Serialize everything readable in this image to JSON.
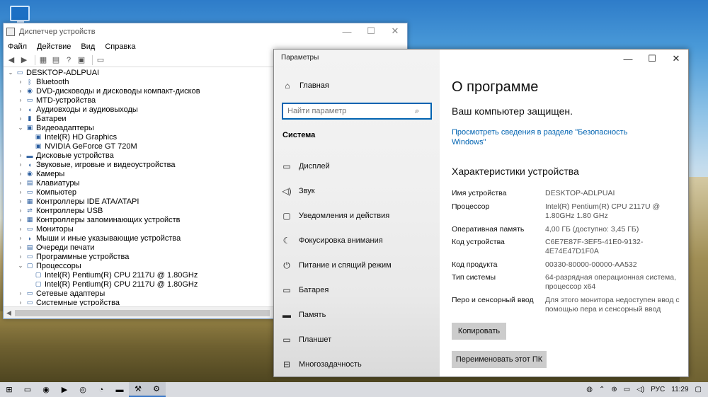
{
  "device_manager": {
    "title": "Диспетчер устройств",
    "menu": [
      "Файл",
      "Действие",
      "Вид",
      "Справка"
    ],
    "root": "DESKTOP-ADLPUAI",
    "nodes": [
      {
        "label": "Bluetooth",
        "expander": "›",
        "icon": "bluetooth-icon",
        "glyph": "ᛒ"
      },
      {
        "label": "DVD-дисководы и дисководы компакт-дисков",
        "expander": "›",
        "icon": "dvd-icon",
        "glyph": "◉"
      },
      {
        "label": "MTD-устройства",
        "expander": "›",
        "icon": "mtd-icon",
        "glyph": "▭"
      },
      {
        "label": "Аудиовходы и аудиовыходы",
        "expander": "›",
        "icon": "audio-icon",
        "glyph": "◖"
      },
      {
        "label": "Батареи",
        "expander": "›",
        "icon": "battery-icon",
        "glyph": "▮"
      },
      {
        "label": "Видеоадаптеры",
        "expander": "⌄",
        "icon": "display-adapter-icon",
        "glyph": "▣"
      },
      {
        "label": "Intel(R) HD Graphics",
        "child": true,
        "icon": "display-adapter-icon",
        "glyph": "▣"
      },
      {
        "label": "NVIDIA GeForce GT 720M",
        "child": true,
        "icon": "display-adapter-icon",
        "glyph": "▣"
      },
      {
        "label": "Дисковые устройства",
        "expander": "›",
        "icon": "disk-icon",
        "glyph": "▬"
      },
      {
        "label": "Звуковые, игровые и видеоустройства",
        "expander": "›",
        "icon": "speaker-icon",
        "glyph": "◖"
      },
      {
        "label": "Камеры",
        "expander": "›",
        "icon": "camera-icon",
        "glyph": "◉"
      },
      {
        "label": "Клавиатуры",
        "expander": "›",
        "icon": "keyboard-icon",
        "glyph": "▤"
      },
      {
        "label": "Компьютер",
        "expander": "›",
        "icon": "computer-icon",
        "glyph": "▭"
      },
      {
        "label": "Контроллеры IDE ATA/ATAPI",
        "expander": "›",
        "icon": "ide-controller-icon",
        "glyph": "▦"
      },
      {
        "label": "Контроллеры USB",
        "expander": "›",
        "icon": "usb-icon",
        "glyph": "⇌"
      },
      {
        "label": "Контроллеры запоминающих устройств",
        "expander": "›",
        "icon": "storage-controller-icon",
        "glyph": "▦"
      },
      {
        "label": "Мониторы",
        "expander": "›",
        "icon": "monitor-icon",
        "glyph": "▭"
      },
      {
        "label": "Мыши и иные указывающие устройства",
        "expander": "›",
        "icon": "mouse-icon",
        "glyph": "◗"
      },
      {
        "label": "Очереди печати",
        "expander": "›",
        "icon": "printer-icon",
        "glyph": "▤"
      },
      {
        "label": "Программные устройства",
        "expander": "›",
        "icon": "software-device-icon",
        "glyph": "▭"
      },
      {
        "label": "Процессоры",
        "expander": "⌄",
        "icon": "cpu-icon",
        "glyph": "▢"
      },
      {
        "label": "Intel(R) Pentium(R) CPU 2117U @ 1.80GHz",
        "child": true,
        "icon": "cpu-icon",
        "glyph": "▢"
      },
      {
        "label": "Intel(R) Pentium(R) CPU 2117U @ 1.80GHz",
        "child": true,
        "icon": "cpu-icon",
        "glyph": "▢"
      },
      {
        "label": "Сетевые адаптеры",
        "expander": "›",
        "icon": "network-adapter-icon",
        "glyph": "▭"
      },
      {
        "label": "Системные устройства",
        "expander": "›",
        "icon": "system-device-icon",
        "glyph": "▭"
      }
    ]
  },
  "settings": {
    "app_title": "Параметры",
    "home": "Главная",
    "search_placeholder": "Найти параметр",
    "section": "Система",
    "nav": [
      {
        "label": "Дисплей",
        "icon": "display-icon",
        "glyph": "▭"
      },
      {
        "label": "Звук",
        "icon": "sound-icon",
        "glyph": "◁)"
      },
      {
        "label": "Уведомления и действия",
        "icon": "notifications-icon",
        "glyph": "▢"
      },
      {
        "label": "Фокусировка внимания",
        "icon": "focus-assist-icon",
        "glyph": "☾"
      },
      {
        "label": "Питание и спящий режим",
        "icon": "power-icon",
        "glyph": "⏻"
      },
      {
        "label": "Батарея",
        "icon": "battery-icon",
        "glyph": "▭"
      },
      {
        "label": "Память",
        "icon": "storage-icon",
        "glyph": "▬"
      },
      {
        "label": "Планшет",
        "icon": "tablet-icon",
        "glyph": "▭"
      },
      {
        "label": "Многозадачность",
        "icon": "multitasking-icon",
        "glyph": "⊟"
      }
    ],
    "about": {
      "title": "О программе",
      "protected": "Ваш компьютер защищен.",
      "security_link": "Просмотреть сведения в разделе \"Безопасность Windows\"",
      "specs_title": "Характеристики устройства",
      "specs": [
        {
          "key": "Имя устройства",
          "value": "DESKTOP-ADLPUAI"
        },
        {
          "key": "Процессор",
          "value": "Intel(R) Pentium(R) CPU 2117U @ 1.80GHz   1.80 GHz"
        },
        {
          "key": "Оперативная память",
          "value": "4,00 ГБ (доступно: 3,45 ГБ)"
        },
        {
          "key": "Код устройства",
          "value": "C6E7E87F-3EF5-41E0-9132-4E74E47D1F0A"
        },
        {
          "key": "Код продукта",
          "value": "00330-80000-00000-AA532"
        },
        {
          "key": "Тип системы",
          "value": "64-разрядная операционная система, процессор x64"
        },
        {
          "key": "Перо и сенсорный ввод",
          "value": "Для этого монитора недоступен ввод с помощью пера и сенсорный ввод"
        }
      ],
      "copy_button": "Копировать",
      "rename_button": "Переименовать этот ПК"
    }
  },
  "taskbar": {
    "lang": "РУС",
    "time": "11:29"
  }
}
